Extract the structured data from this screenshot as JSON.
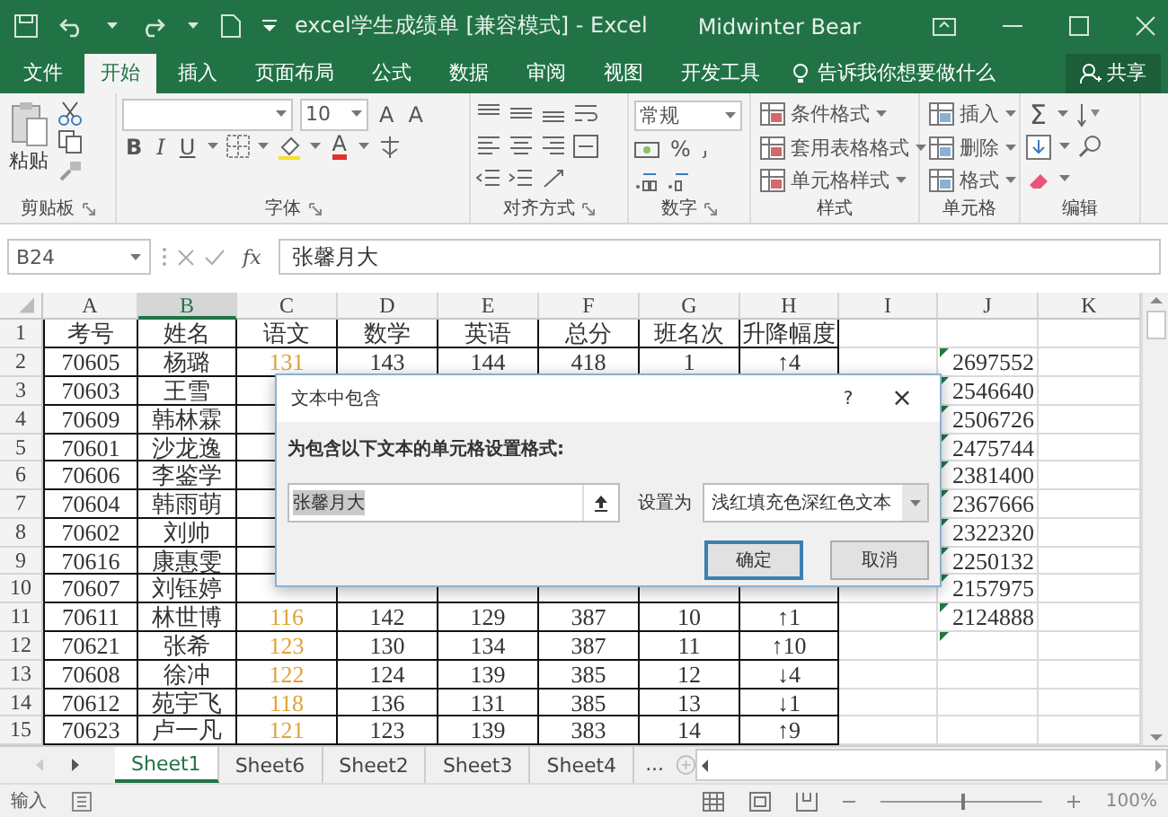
{
  "window": {
    "title": "excel学生成绩单  [兼容模式]  -  Excel",
    "user": "Midwinter Bear"
  },
  "tabs": [
    {
      "label": "文件",
      "selected": false
    },
    {
      "label": "开始",
      "selected": true
    },
    {
      "label": "插入",
      "selected": false
    },
    {
      "label": "页面布局",
      "selected": false
    },
    {
      "label": "公式",
      "selected": false
    },
    {
      "label": "数据",
      "selected": false
    },
    {
      "label": "审阅",
      "selected": false
    },
    {
      "label": "视图",
      "selected": false
    },
    {
      "label": "开发工具",
      "selected": false
    }
  ],
  "tell_me": {
    "placeholder": "告诉我你想要做什么"
  },
  "share_button": "共享",
  "ribbon": {
    "groups": [
      {
        "label": "剪贴板",
        "paste": "粘贴"
      },
      {
        "label": "字体",
        "font_size": "10",
        "grow": "A",
        "shrink": "A",
        "bold": "B",
        "italic": "I",
        "underline": "U",
        "font_color": "A"
      },
      {
        "label": "对齐方式"
      },
      {
        "label": "数字",
        "format": "常规",
        "percent": "%"
      },
      {
        "label": "样式",
        "buttons": [
          "条件格式",
          "套用表格格式",
          "单元格样式"
        ]
      },
      {
        "label": "单元格",
        "buttons": [
          "插入",
          "删除",
          "格式"
        ]
      },
      {
        "label": "编辑",
        "autosum": "Σ"
      }
    ]
  },
  "formula_bar": {
    "name_box": "B24",
    "function_label": "fx",
    "value": "张馨月大"
  },
  "sheet": {
    "columns": [
      {
        "letter": "A",
        "selected": false
      },
      {
        "letter": "B",
        "selected": true
      },
      {
        "letter": "C",
        "selected": false,
        "color": "#e0a23a"
      },
      {
        "letter": "D",
        "selected": false
      },
      {
        "letter": "E",
        "selected": false
      },
      {
        "letter": "F",
        "selected": false
      },
      {
        "letter": "G",
        "selected": false
      },
      {
        "letter": "H",
        "selected": false
      },
      {
        "letter": "I",
        "selected": false
      },
      {
        "letter": "J",
        "selected": false
      },
      {
        "letter": "K",
        "selected": false
      }
    ],
    "rows": [
      {
        "number": "1",
        "kind": "header",
        "number_as_text": false,
        "cells": [
          "考号",
          "姓名",
          "语文",
          "数学",
          "英语",
          "总分",
          "班名次",
          "升降幅度",
          null,
          null,
          null
        ]
      },
      {
        "number": "2",
        "kind": "data",
        "number_as_text": true,
        "cells": [
          "70605",
          "杨璐",
          "131",
          "143",
          "144",
          "418",
          "1",
          "↑4",
          null,
          "2697552",
          null
        ]
      },
      {
        "number": "3",
        "kind": "data",
        "number_as_text": true,
        "cells": [
          "70603",
          "王雪",
          null,
          null,
          null,
          null,
          null,
          null,
          null,
          "2546640",
          null
        ]
      },
      {
        "number": "4",
        "kind": "data",
        "number_as_text": true,
        "cells": [
          "70609",
          "韩林霖",
          null,
          null,
          null,
          null,
          null,
          null,
          null,
          "2506726",
          null
        ]
      },
      {
        "number": "5",
        "kind": "data",
        "number_as_text": true,
        "cells": [
          "70601",
          "沙龙逸",
          null,
          null,
          null,
          null,
          null,
          null,
          null,
          "2475744",
          null
        ]
      },
      {
        "number": "6",
        "kind": "data",
        "number_as_text": true,
        "cells": [
          "70606",
          "李鉴学",
          null,
          null,
          null,
          null,
          null,
          null,
          null,
          "2381400",
          null
        ]
      },
      {
        "number": "7",
        "kind": "data",
        "number_as_text": true,
        "cells": [
          "70604",
          "韩雨萌",
          null,
          null,
          null,
          null,
          null,
          null,
          null,
          "2367666",
          null
        ]
      },
      {
        "number": "8",
        "kind": "data",
        "number_as_text": true,
        "cells": [
          "70602",
          "刘帅",
          null,
          null,
          null,
          null,
          null,
          null,
          null,
          "2322320",
          null
        ]
      },
      {
        "number": "9",
        "kind": "data",
        "number_as_text": true,
        "cells": [
          "70616",
          "康惠雯",
          null,
          null,
          null,
          null,
          null,
          null,
          null,
          "2250132",
          null
        ]
      },
      {
        "number": "10",
        "kind": "data",
        "number_as_text": true,
        "cells": [
          "70607",
          "刘钰婷",
          null,
          null,
          null,
          null,
          null,
          null,
          null,
          "2157975",
          null
        ]
      },
      {
        "number": "11",
        "kind": "data",
        "number_as_text": true,
        "cells": [
          "70611",
          "林世博",
          "116",
          "142",
          "129",
          "387",
          "10",
          "↑1",
          null,
          "2124888",
          null
        ]
      },
      {
        "number": "12",
        "kind": "data",
        "number_as_text": true,
        "cells": [
          "70621",
          "张希",
          "123",
          "130",
          "134",
          "387",
          "11",
          "↑10",
          null,
          null,
          null
        ]
      },
      {
        "number": "13",
        "kind": "data",
        "number_as_text": false,
        "cells": [
          "70608",
          "徐冲",
          "122",
          "124",
          "139",
          "385",
          "12",
          "↓4",
          null,
          null,
          null
        ]
      },
      {
        "number": "14",
        "kind": "data",
        "number_as_text": false,
        "cells": [
          "70612",
          "苑宇飞",
          "118",
          "136",
          "131",
          "385",
          "13",
          "↓1",
          null,
          null,
          null
        ]
      },
      {
        "number": "15",
        "kind": "data",
        "number_as_text": false,
        "cells": [
          "70623",
          "卢一凡",
          "121",
          "123",
          "139",
          "383",
          "14",
          "↑9",
          null,
          null,
          null
        ]
      }
    ]
  },
  "dialog": {
    "title": "文本中包含",
    "help": "?",
    "close": "×",
    "prompt": "为包含以下文本的单元格设置格式:",
    "value": "张馨月大",
    "value_selected": true,
    "format_label": "设置为",
    "format_value": "浅红填充色深红色文本",
    "buttons": [
      {
        "label": "确定",
        "default": true
      },
      {
        "label": "取消",
        "default": false
      }
    ]
  },
  "sheet_tabs": [
    {
      "label": "Sheet1",
      "selected": true
    },
    {
      "label": "Sheet6",
      "selected": false
    },
    {
      "label": "Sheet2",
      "selected": false
    },
    {
      "label": "Sheet3",
      "selected": false
    },
    {
      "label": "Sheet4",
      "selected": false
    }
  ],
  "more_sheets": "...",
  "status_bar": {
    "mode": "输入",
    "zoom": "100%",
    "zoom_slider": {
      "level": 0.5
    }
  }
}
